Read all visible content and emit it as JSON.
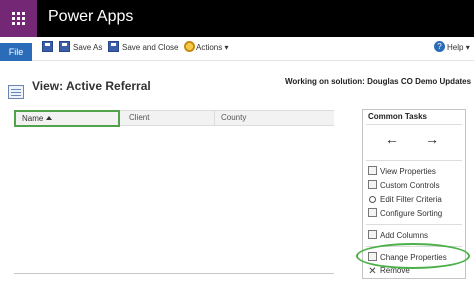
{
  "app": {
    "title": "Power Apps"
  },
  "command_bar": {
    "file_label": "File",
    "save_as_label": "Save As",
    "save_close_label": "Save and Close",
    "actions_label": "Actions",
    "help_label": "Help"
  },
  "view": {
    "title": "View: Active Referral",
    "solution": "Working on solution: Douglas CO Demo Updates"
  },
  "grid": {
    "columns": [
      "Name",
      "Client",
      "County"
    ]
  },
  "common_tasks": {
    "title": "Common Tasks",
    "back_arrow": "←",
    "forward_arrow": "→",
    "items": [
      "View Properties",
      "Custom Controls",
      "Edit Filter Criteria",
      "Configure Sorting",
      "Add Columns",
      "Change Properties",
      "Remove"
    ]
  },
  "colors": {
    "waffle": "#742774",
    "file_button": "#2b6cb8",
    "highlight": "#4cb04a"
  }
}
